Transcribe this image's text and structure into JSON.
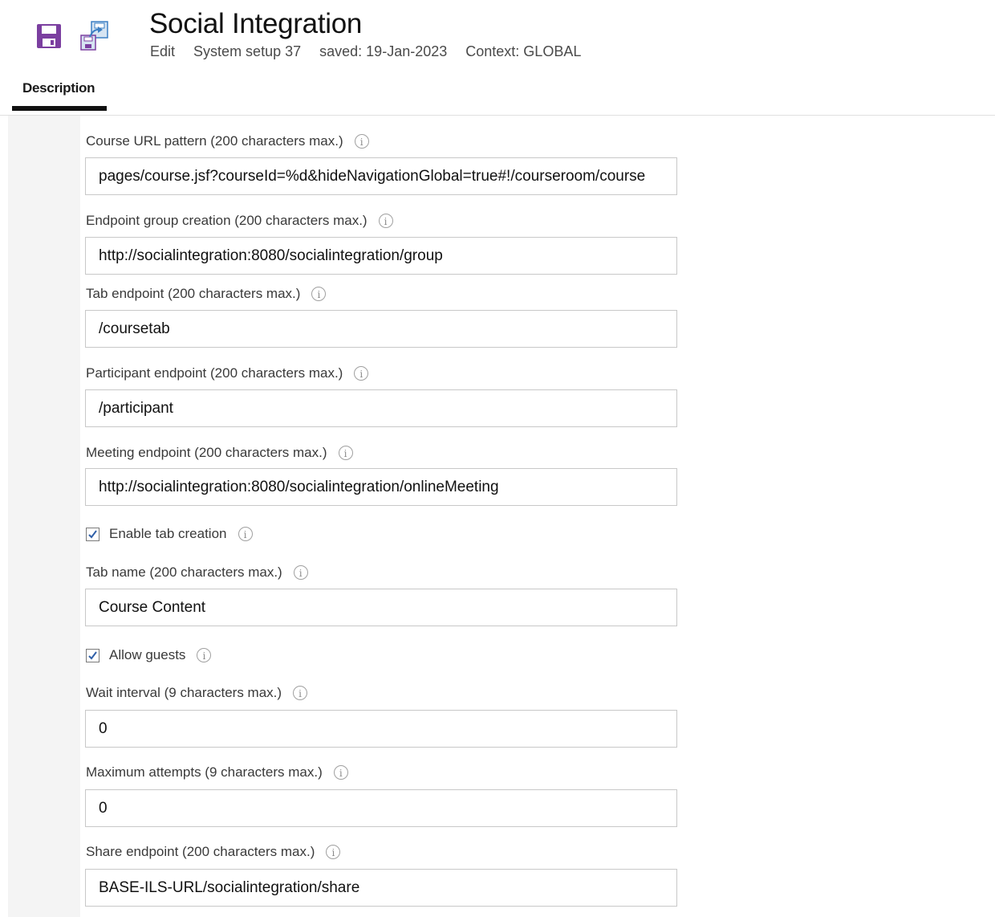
{
  "header": {
    "title": "Social Integration",
    "mode": "Edit",
    "setup": "System setup 37",
    "saved": "saved: 19-Jan-2023",
    "context": "Context: GLOBAL"
  },
  "tabs": [
    {
      "label": "Description"
    }
  ],
  "colors": {
    "accent": "#7b3fa0",
    "icon_blue": "#3b7fc4"
  },
  "icons": {
    "save": "save-icon",
    "save_as": "save-as-icon",
    "info": "info-icon"
  },
  "fields": {
    "course_url": {
      "label": "Course URL pattern (200 characters max.)",
      "value": "pages/course.jsf?courseId=%d&hideNavigationGlobal=true#!/courseroom/course"
    },
    "group_creation": {
      "label": "Endpoint group creation (200 characters max.)",
      "value": "http://socialintegration:8080/socialintegration/group"
    },
    "tab_endpoint": {
      "label": "Tab endpoint (200 characters max.)",
      "value": "/coursetab"
    },
    "participant_endpoint": {
      "label": "Participant endpoint (200 characters max.)",
      "value": "/participant"
    },
    "meeting_endpoint": {
      "label": "Meeting endpoint (200 characters max.)",
      "value": "http://socialintegration:8080/socialintegration/onlineMeeting"
    },
    "enable_tab_creation": {
      "label": "Enable tab creation",
      "checked": true
    },
    "tab_name": {
      "label": "Tab name (200 characters max.)",
      "value": "Course Content"
    },
    "allow_guests": {
      "label": "Allow guests",
      "checked": true
    },
    "wait_interval": {
      "label": "Wait interval (9 characters max.)",
      "value": "0"
    },
    "max_attempts": {
      "label": "Maximum attempts (9 characters max.)",
      "value": "0"
    },
    "share_endpoint": {
      "label": "Share endpoint (200 characters max.)",
      "value": "BASE-ILS-URL/socialintegration/share"
    }
  }
}
